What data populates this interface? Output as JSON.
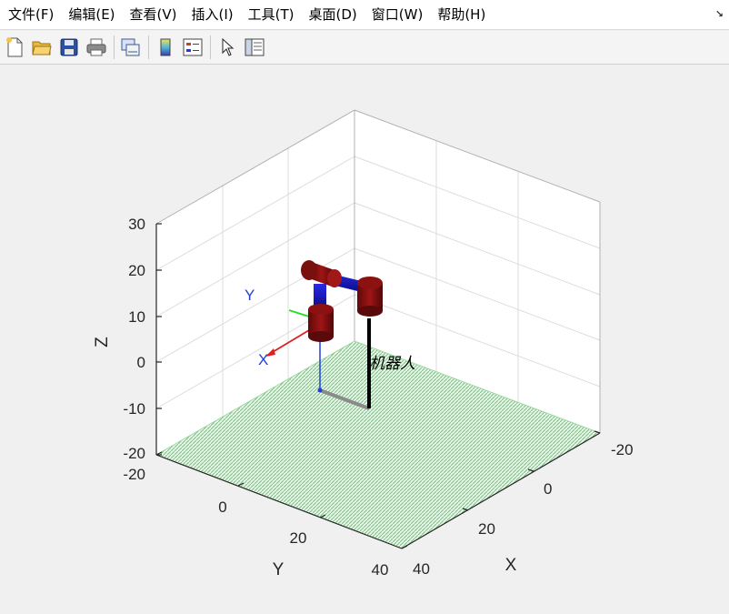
{
  "menu": [
    {
      "label": "文件(F)"
    },
    {
      "label": "编辑(E)"
    },
    {
      "label": "查看(V)"
    },
    {
      "label": "插入(I)"
    },
    {
      "label": "工具(T)"
    },
    {
      "label": "桌面(D)"
    },
    {
      "label": "窗口(W)"
    },
    {
      "label": "帮助(H)"
    }
  ],
  "dock_glyph": "↘",
  "toolbar": [
    {
      "icon": "new-figure-icon"
    },
    {
      "icon": "open-file-icon"
    },
    {
      "icon": "save-icon"
    },
    {
      "icon": "print-icon"
    },
    {
      "icon": "link-plot-icon"
    },
    {
      "icon": "insert-colorbar-icon"
    },
    {
      "icon": "insert-legend-icon"
    },
    {
      "icon": "edit-plot-pointer-icon"
    },
    {
      "icon": "property-inspector-icon"
    }
  ],
  "plot": {
    "z_ticks": [
      "30",
      "20",
      "10",
      "0",
      "-10",
      "-20"
    ],
    "y_ticks": [
      "-20",
      "0",
      "20",
      "40"
    ],
    "x_ticks": [
      "-20",
      "0",
      "20",
      "40"
    ],
    "xlabel": "X",
    "ylabel": "Y",
    "zlabel": "Z",
    "frame_label_x": "X",
    "frame_label_y": "Y",
    "robot_label": "机器人",
    "floor_color": "#6fd17a",
    "link_dark_red": "#7a0f0f",
    "link_blue": "#1010c8"
  }
}
